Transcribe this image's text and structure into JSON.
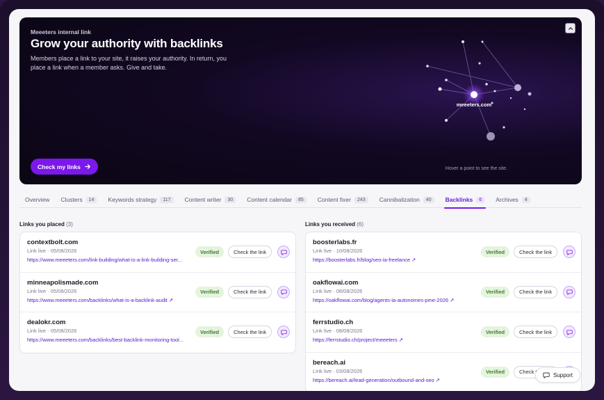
{
  "hero": {
    "eyebrow": "Meeeters internal link",
    "title": "Grow your authority with backlinks",
    "description": "Members place a link to your site, it raises your authority. In return, you place a link when a member asks. Give and take.",
    "cta_label": "Check my links",
    "center_label": "meeeters.com",
    "hint": "Hover a point to see the site."
  },
  "tabs": [
    {
      "label": "Overview",
      "count": ""
    },
    {
      "label": "Clusters",
      "count": "14"
    },
    {
      "label": "Keywords strategy",
      "count": "117"
    },
    {
      "label": "Content writer",
      "count": "30"
    },
    {
      "label": "Content calendar",
      "count": "85"
    },
    {
      "label": "Content fixer",
      "count": "243"
    },
    {
      "label": "Cannibalization",
      "count": "40"
    },
    {
      "label": "Backlinks",
      "count": "6"
    },
    {
      "label": "Archives",
      "count": "4"
    }
  ],
  "active_tab": "Backlinks",
  "placed": {
    "title": "Links you placed",
    "count": "(3)",
    "items": [
      {
        "domain": "contextbolt.com",
        "meta": "Link live · 05/08/2026",
        "url": "https://www.meeeters.com/link-building/what-is-a-link-building-ser...",
        "badge": "Verified",
        "action": "Check the link"
      },
      {
        "domain": "minneapolismade.com",
        "meta": "Link live · 05/08/2026",
        "url": "https://www.meeeters.com/backlinks/what-is-a-backlink-audit ↗",
        "badge": "Verified",
        "action": "Check the link"
      },
      {
        "domain": "dealokr.com",
        "meta": "Link live · 05/08/2026",
        "url": "https://www.meeeters.com/backlinks/best-backlink-monitoring-tool...",
        "badge": "Verified",
        "action": "Check the link"
      }
    ]
  },
  "received": {
    "title": "Links you received",
    "count": "(6)",
    "items": [
      {
        "domain": "boosterlabs.fr",
        "meta": "Link live · 10/08/2026",
        "url": "https://boosterlabs.fr/blog/seo-ia-freelance ↗",
        "badge": "Verified",
        "action": "Check the link"
      },
      {
        "domain": "oakflowai.com",
        "meta": "Link live · 08/08/2026",
        "url": "https://oakflowai.com/blog/agents-ia-autonomes-pme-2026 ↗",
        "badge": "Verified",
        "action": "Check the link"
      },
      {
        "domain": "ferrstudio.ch",
        "meta": "Link live · 08/08/2026",
        "url": "https://ferrstudio.ch/project/meeeters ↗",
        "badge": "Verified",
        "action": "Check the link"
      },
      {
        "domain": "bereach.ai",
        "meta": "Link live · 03/08/2026",
        "url": "https://bereach.ai/lead-generation/outbound-and-seo ↗",
        "badge": "Verified",
        "action": "Check the link"
      }
    ]
  },
  "support_label": "Support",
  "colors": {
    "accent": "#7b18ea",
    "verified_bg": "#e5f3df",
    "verified_text": "#3f7d2c",
    "link": "#5a13c9"
  },
  "icons": {
    "cta": "arrow-right-icon",
    "collapse": "chevron-up-icon",
    "message": "message-icon",
    "support": "chat-icon"
  }
}
